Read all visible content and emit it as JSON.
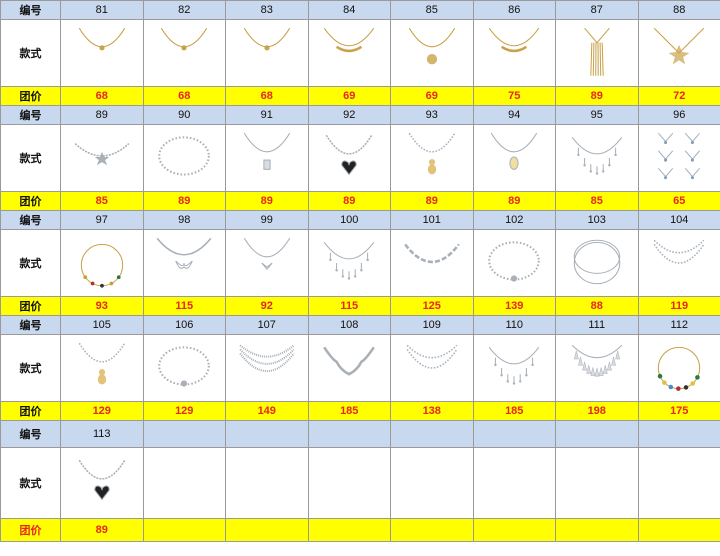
{
  "labels": {
    "id": "编号",
    "style": "款式",
    "price": "团价"
  },
  "blocks": [
    {
      "ids": [
        "81",
        "82",
        "83",
        "84",
        "85",
        "86",
        "87",
        "88"
      ],
      "prices": [
        "68",
        "68",
        "68",
        "69",
        "69",
        "75",
        "89",
        "72"
      ],
      "items": [
        {
          "name": "v-pendant-necklace",
          "type": "pendant",
          "color": "gold"
        },
        {
          "name": "small-pendant-necklace",
          "type": "pendant",
          "color": "gold"
        },
        {
          "name": "small-pendant-necklace",
          "type": "pendant",
          "color": "gold"
        },
        {
          "name": "wave-bar-necklace",
          "type": "bar",
          "color": "gold"
        },
        {
          "name": "locket-necklace",
          "type": "locket",
          "color": "gold"
        },
        {
          "name": "dotted-bar-necklace",
          "type": "bar",
          "color": "gold"
        },
        {
          "name": "tassel-necklace",
          "type": "tassel",
          "color": "gold"
        },
        {
          "name": "star-cluster-necklace",
          "type": "cluster",
          "color": "gold"
        }
      ]
    },
    {
      "ids": [
        "89",
        "90",
        "91",
        "92",
        "93",
        "94",
        "95",
        "96"
      ],
      "prices": [
        "85",
        "89",
        "89",
        "89",
        "89",
        "89",
        "85",
        "65"
      ],
      "items": [
        {
          "name": "star-chain-necklace",
          "type": "starchain",
          "color": "silver"
        },
        {
          "name": "pearl-chain-necklace",
          "type": "pearl",
          "color": "silver"
        },
        {
          "name": "crystal-drop-necklace",
          "type": "drop",
          "color": "silver"
        },
        {
          "name": "black-heart-necklace",
          "type": "heart",
          "color": "silver"
        },
        {
          "name": "bear-pearl-necklace",
          "type": "bear",
          "color": "silver"
        },
        {
          "name": "cameo-pearl-necklace",
          "type": "cameo",
          "color": "silver"
        },
        {
          "name": "dangle-charm-necklace",
          "type": "dangle",
          "color": "silver"
        },
        {
          "name": "multi-star-set",
          "type": "set",
          "color": "silver"
        }
      ]
    },
    {
      "ids": [
        "97",
        "98",
        "99",
        "100",
        "101",
        "102",
        "103",
        "104"
      ],
      "prices": [
        "93",
        "115",
        "92",
        "115",
        "125",
        "139",
        "88",
        "119"
      ],
      "items": [
        {
          "name": "gemstone-chain-necklace",
          "type": "gems",
          "color": "gold"
        },
        {
          "name": "bow-chain-necklace",
          "type": "bow",
          "color": "silver"
        },
        {
          "name": "bow-pendant-necklace",
          "type": "bowpend",
          "color": "silver"
        },
        {
          "name": "drop-fringe-necklace",
          "type": "fringe",
          "color": "silver"
        },
        {
          "name": "link-chain-necklace",
          "type": "links",
          "color": "silver"
        },
        {
          "name": "pearl-choker",
          "type": "pearlchoker",
          "color": "silver"
        },
        {
          "name": "double-hoop-necklace",
          "type": "hoop",
          "color": "silver"
        },
        {
          "name": "layered-pearl-necklace",
          "type": "layered",
          "color": "silver"
        }
      ]
    },
    {
      "ids": [
        "105",
        "106",
        "107",
        "108",
        "109",
        "110",
        "111",
        "112"
      ],
      "prices": [
        "129",
        "129",
        "149",
        "185",
        "138",
        "185",
        "198",
        "175"
      ],
      "items": [
        {
          "name": "layered-bear-necklace",
          "type": "bear",
          "color": "silver"
        },
        {
          "name": "pearl-disc-necklace",
          "type": "pearlchoker",
          "color": "silver"
        },
        {
          "name": "triple-tennis-necklace",
          "type": "tennis",
          "color": "silver"
        },
        {
          "name": "twisted-vine-necklace",
          "type": "vine",
          "color": "silver"
        },
        {
          "name": "layered-chain-necklace",
          "type": "layered",
          "color": "silver"
        },
        {
          "name": "crystal-fringe-necklace",
          "type": "fringe",
          "color": "silver"
        },
        {
          "name": "statement-crystal-necklace",
          "type": "statement",
          "color": "silver"
        },
        {
          "name": "colored-bead-necklace",
          "type": "beads",
          "color": "gold"
        }
      ]
    },
    {
      "ids": [
        "113"
      ],
      "prices": [
        "89"
      ],
      "items": [
        {
          "name": "black-heart-chain-necklace",
          "type": "heart",
          "color": "silver"
        }
      ]
    }
  ],
  "colors": {
    "id_bg": "#c8d8ee",
    "price_bg": "#ffff00",
    "price_text": "#e8261c",
    "gold": "#c9a24a",
    "silver": "#a9b0b8"
  }
}
